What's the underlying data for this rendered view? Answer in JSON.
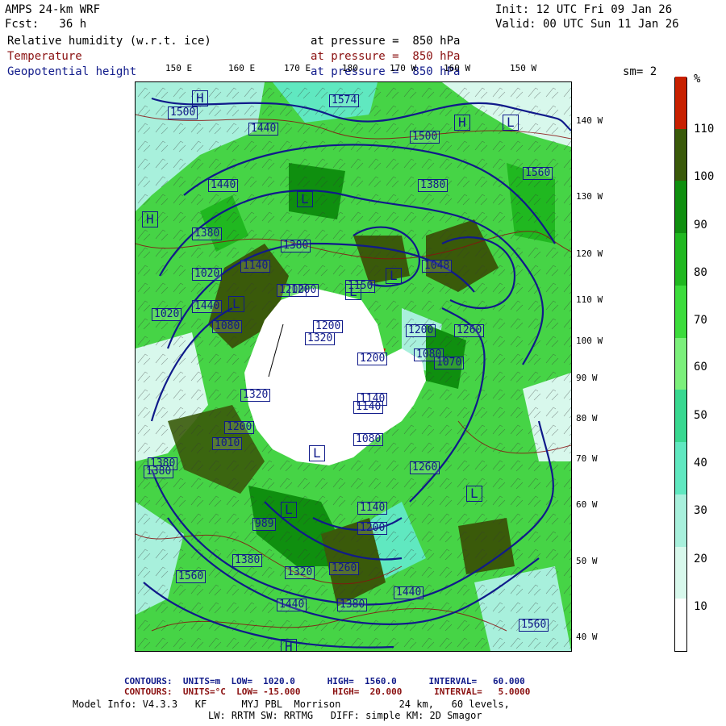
{
  "header": {
    "model": "AMPS 24-km WRF",
    "init": "Init: 12 UTC Fri 09 Jan 26",
    "fcst": "Fcst:   36 h",
    "valid": "Valid: 00 UTC Sun 11 Jan 26"
  },
  "fields": {
    "rh_label": "Relative humidity (w.r.t. ice)",
    "rh_level": "at pressure =  850 hPa",
    "temp_label": "Temperature",
    "temp_level": "at pressure =  850 hPa",
    "gph_label": "Geopotential height",
    "gph_level": "at pressure =  850 hPa",
    "smoothing": "sm= 2"
  },
  "map": {
    "lon_labels": [
      "150 E",
      "160 E",
      "170 E",
      "180",
      "170 W",
      "160 W",
      "150 W"
    ],
    "lat_labels": [
      "140 W",
      "130 W",
      "120 W",
      "110 W",
      "100 W",
      "90 W",
      "80 W",
      "70 W",
      "60 W",
      "50 W",
      "40 W"
    ],
    "height_labels": [
      "1500",
      "1440",
      "1500",
      "1380",
      "1440",
      "1560",
      "1380",
      "1320",
      "1440",
      "1380",
      "1140",
      "1020",
      "1020",
      "1048",
      "1200",
      "1080",
      "1200",
      "1200",
      "1260",
      "1080",
      "1200",
      "1320",
      "1200",
      "1140",
      "1380",
      "1010",
      "1080",
      "1070",
      "1380",
      "1260",
      "1140",
      "989",
      "1200",
      "1380",
      "1320",
      "1260",
      "1560",
      "1440",
      "1380",
      "1440",
      "1560",
      "1574",
      "1200",
      "1150",
      "1140"
    ],
    "pressure_centers": [
      "H",
      "L",
      "H",
      "L",
      "L",
      "L",
      "L",
      "H",
      "L",
      "L",
      "H",
      "L"
    ]
  },
  "colorbar": {
    "unit": "%",
    "ticks": [
      "110",
      "100",
      "90",
      "80",
      "70",
      "60",
      "50",
      "40",
      "30",
      "20",
      "10"
    ],
    "colors": [
      "#ffffff",
      "#d8f8ec",
      "#a8f0dc",
      "#60e8c0",
      "#38d890",
      "#7cf07c",
      "#3cdc3c",
      "#20b820",
      "#0f8f0f",
      "#3a5a0a",
      "#c82000"
    ]
  },
  "footer": {
    "contours1": "CONTOURS:  UNITS=m  LOW=  1020.0      HIGH=  1560.0      INTERVAL=   60.000",
    "contours2": "CONTOURS:  UNITS=°C  LOW= -15.000      HIGH=  20.000      INTERVAL=   5.0000",
    "model_info": "Model Info: V4.3.3   KF      MYJ PBL  Morrison          24 km,   60 levels,",
    "physics": "LW: RRTM SW: RRTMG   DIFF: simple KM: 2D Smagor"
  }
}
